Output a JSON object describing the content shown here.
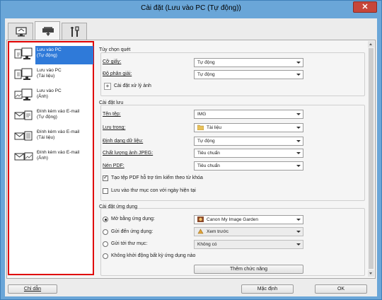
{
  "window": {
    "title": "Cài đặt (Lưu vào PC (Tự động))",
    "close_glyph": "✕"
  },
  "tabs": [
    {
      "icon": "computer-scan-icon"
    },
    {
      "icon": "scanner-icon"
    },
    {
      "icon": "tools-icon"
    }
  ],
  "sidebar": {
    "items": [
      {
        "line1": "Lưu vào PC",
        "line2": "(Tự động)",
        "icon": "computer-save-icon",
        "selected": true
      },
      {
        "line1": "Lưu vào PC",
        "line2": "(Tài liệu)",
        "icon": "computer-save-icon"
      },
      {
        "line1": "Lưu vào PC",
        "line2": "(Ảnh)",
        "icon": "computer-save-icon"
      },
      {
        "line1": "Đính kèm vào E-mail",
        "line2": "(Tự động)",
        "icon": "email-attach-icon"
      },
      {
        "line1": "Đính kèm vào E-mail",
        "line2": "(Tài liệu)",
        "icon": "email-attach-icon"
      },
      {
        "line1": "Đính kèm vào E-mail",
        "line2": "(Ảnh)",
        "icon": "email-attach-icon"
      }
    ]
  },
  "scan_options": {
    "title": "Tùy chọn quét",
    "paper_size_label": "Cỡ giấy:",
    "paper_size_value": "Tự động",
    "resolution_label": "Độ phân giải:",
    "resolution_value": "Tự động",
    "image_processing_label": "Cài đặt xử lý ảnh",
    "plus_glyph": "+"
  },
  "save_settings": {
    "title": "Cài đặt lưu",
    "file_name_label": "Tên tệp:",
    "file_name_value": "IMG",
    "save_in_label": "Lưu trong:",
    "save_in_value": "Tài liệu",
    "data_format_label": "Định dạng dữ liệu:",
    "data_format_value": "Tự động",
    "jpeg_quality_label": "Chất lượng ảnh JPEG:",
    "jpeg_quality_value": "Tiêu chuẩn",
    "pdf_compression_label": "Nén PDF:",
    "pdf_compression_value": "Tiêu chuẩn",
    "searchable_pdf_label": "Tạo tệp PDF hỗ trợ tìm kiếm theo từ khóa",
    "searchable_pdf_checked": true,
    "subfolder_label": "Lưu vào thư mục con với ngày hiện tại",
    "subfolder_checked": false
  },
  "app_settings": {
    "title": "Cài đặt ứng dụng",
    "open_with_label": "Mở bằng ứng dụng:",
    "open_with_value": "Canon My Image Garden",
    "send_to_app_label": "Gửi đến ứng dụng:",
    "send_to_app_value": "Xem trước",
    "send_to_folder_label": "Gửi tới thư mục:",
    "send_to_folder_value": "Không có",
    "no_app_label": "Không khởi động bất kỳ ứng dụng nào",
    "more_functions_label": "Thêm chức năng"
  },
  "footer": {
    "instructions_label": "Chỉ dẫn",
    "defaults_label": "Mặc định",
    "ok_label": "OK"
  },
  "colors": {
    "highlight_border": "#e00000",
    "selection": "#2f7ad9",
    "title_bar": "#6aa6d8"
  }
}
